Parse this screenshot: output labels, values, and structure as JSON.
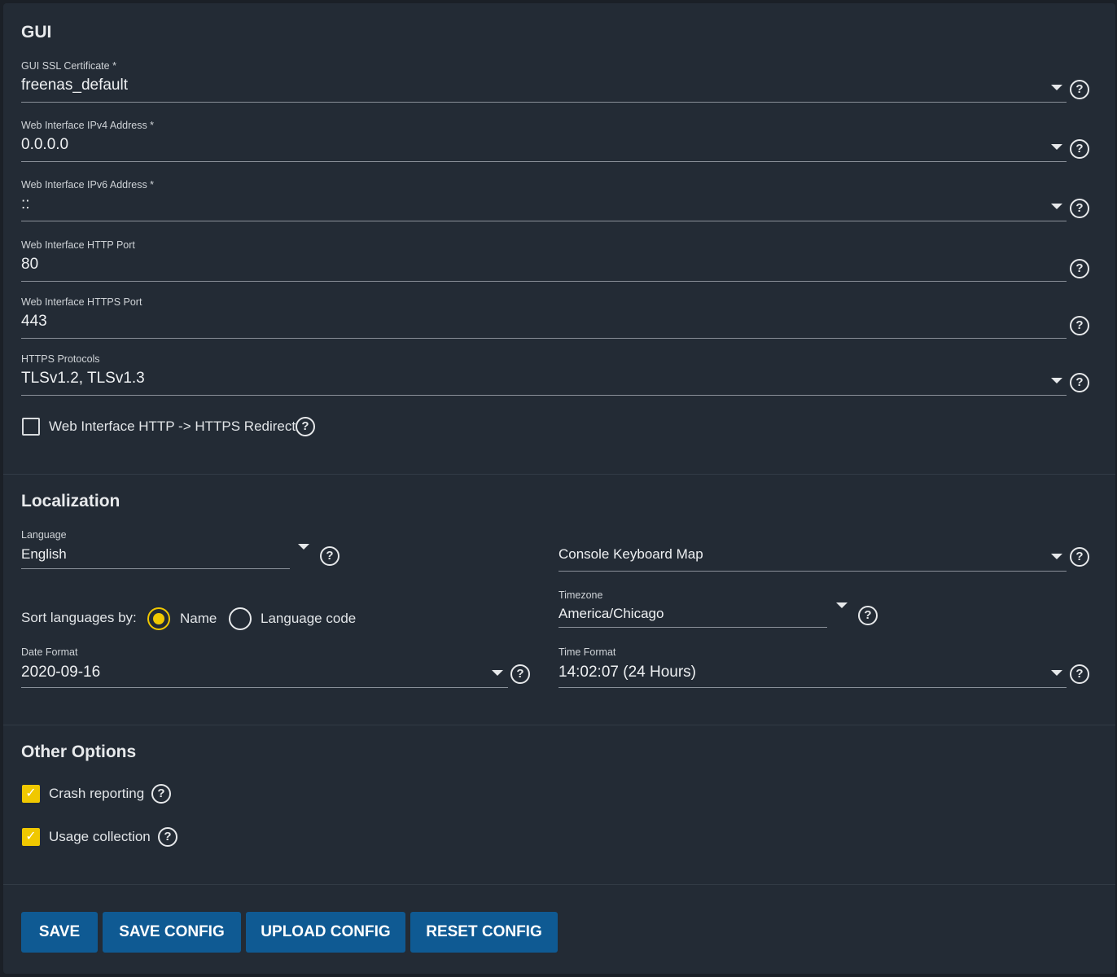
{
  "gui": {
    "title": "GUI",
    "fields": [
      {
        "label": "GUI SSL Certificate *",
        "value": "freenas_default"
      },
      {
        "label": "Web Interface IPv4 Address *",
        "value": "0.0.0.0"
      },
      {
        "label": "Web Interface IPv6 Address *",
        "value": "::"
      },
      {
        "label": "Web Interface HTTP Port",
        "value": "80"
      },
      {
        "label": "Web Interface HTTPS Port",
        "value": "443"
      },
      {
        "label": "HTTPS Protocols",
        "value": "TLSv1.2, TLSv1.3"
      }
    ],
    "redirect": {
      "label": "Web Interface HTTP -> HTTPS Redirect",
      "checked": false
    }
  },
  "localization": {
    "title": "Localization",
    "language": {
      "label": "Language",
      "value": "English"
    },
    "keyboard": {
      "placeholder": "Console Keyboard Map"
    },
    "sort": {
      "label": "Sort languages by:",
      "options": [
        "Name",
        "Language code"
      ],
      "selected": "Name"
    },
    "timezone": {
      "label": "Timezone",
      "value": "America/Chicago"
    },
    "date_format": {
      "label": "Date Format",
      "value": "2020-09-16"
    },
    "time_format": {
      "label": "Time Format",
      "value": "14:02:07 (24 Hours)"
    }
  },
  "other": {
    "title": "Other Options",
    "crash": {
      "label": "Crash reporting",
      "checked": true
    },
    "usage": {
      "label": "Usage collection",
      "checked": true
    }
  },
  "buttons": {
    "save": "SAVE",
    "save_config": "SAVE CONFIG",
    "upload_config": "UPLOAD CONFIG",
    "reset_config": "RESET CONFIG"
  },
  "help_glyph": "?",
  "check_glyph": "✓",
  "colors": {
    "accent": "#f0c800",
    "button": "#0f5a93",
    "background": "#232b35"
  }
}
